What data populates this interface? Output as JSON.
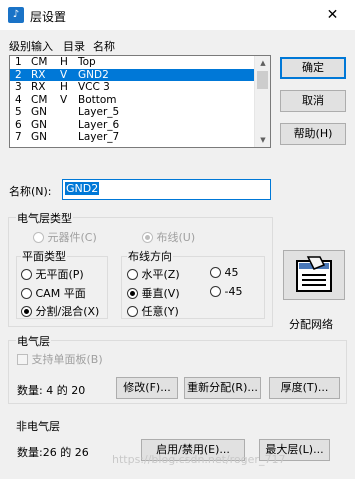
{
  "window": {
    "title": "层设置",
    "close_glyph": "✕",
    "icon_glyph": "♪"
  },
  "list": {
    "headers": [
      "级别输入",
      "目录",
      "名称"
    ],
    "rows": [
      {
        "num": "1",
        "type": "CM",
        "flag": "H",
        "name": "Top"
      },
      {
        "num": "2",
        "type": "RX",
        "flag": "V",
        "name": "GND2"
      },
      {
        "num": "3",
        "type": "RX",
        "flag": "H",
        "name": "VCC 3"
      },
      {
        "num": "4",
        "type": "CM",
        "flag": "V",
        "name": "Bottom"
      },
      {
        "num": "5",
        "type": "GN",
        "flag": "",
        "name": "Layer_5"
      },
      {
        "num": "6",
        "type": "GN",
        "flag": "",
        "name": "Layer_6"
      },
      {
        "num": "7",
        "type": "GN",
        "flag": "",
        "name": "Layer_7"
      }
    ],
    "selected_index": 1
  },
  "buttons": {
    "ok": "确定",
    "cancel": "取消",
    "help": "帮助(H)"
  },
  "name_field": {
    "label": "名称(N):",
    "value": "GND2"
  },
  "electrical_type": {
    "title": "电气层类型",
    "component": "元器件(C)",
    "routing": "布线(U)"
  },
  "plane_type": {
    "title": "平面类型",
    "options": [
      "无平面(P)",
      "CAM 平面",
      "分割/混合(X)"
    ],
    "selected": 2
  },
  "route_dir": {
    "title": "布线方向",
    "options": [
      "水平(Z)",
      "垂直(V)",
      "任意(Y)",
      "45",
      "-45"
    ],
    "selected": 1
  },
  "assign_net": {
    "label": "分配网络"
  },
  "electrical": {
    "title": "电气层",
    "single_side": "支持单面板(B)",
    "count": "数量: 4 的 20",
    "modify": "修改(F)...",
    "reassign": "重新分配(R)...",
    "thickness": "厚度(T)..."
  },
  "non_electrical": {
    "title": "非电气层",
    "count": "数量:26 的 26",
    "enable": "启用/禁用(E)...",
    "max_layers": "最大层(L)..."
  },
  "watermark": "https://blog.csdn.net/roger_717"
}
